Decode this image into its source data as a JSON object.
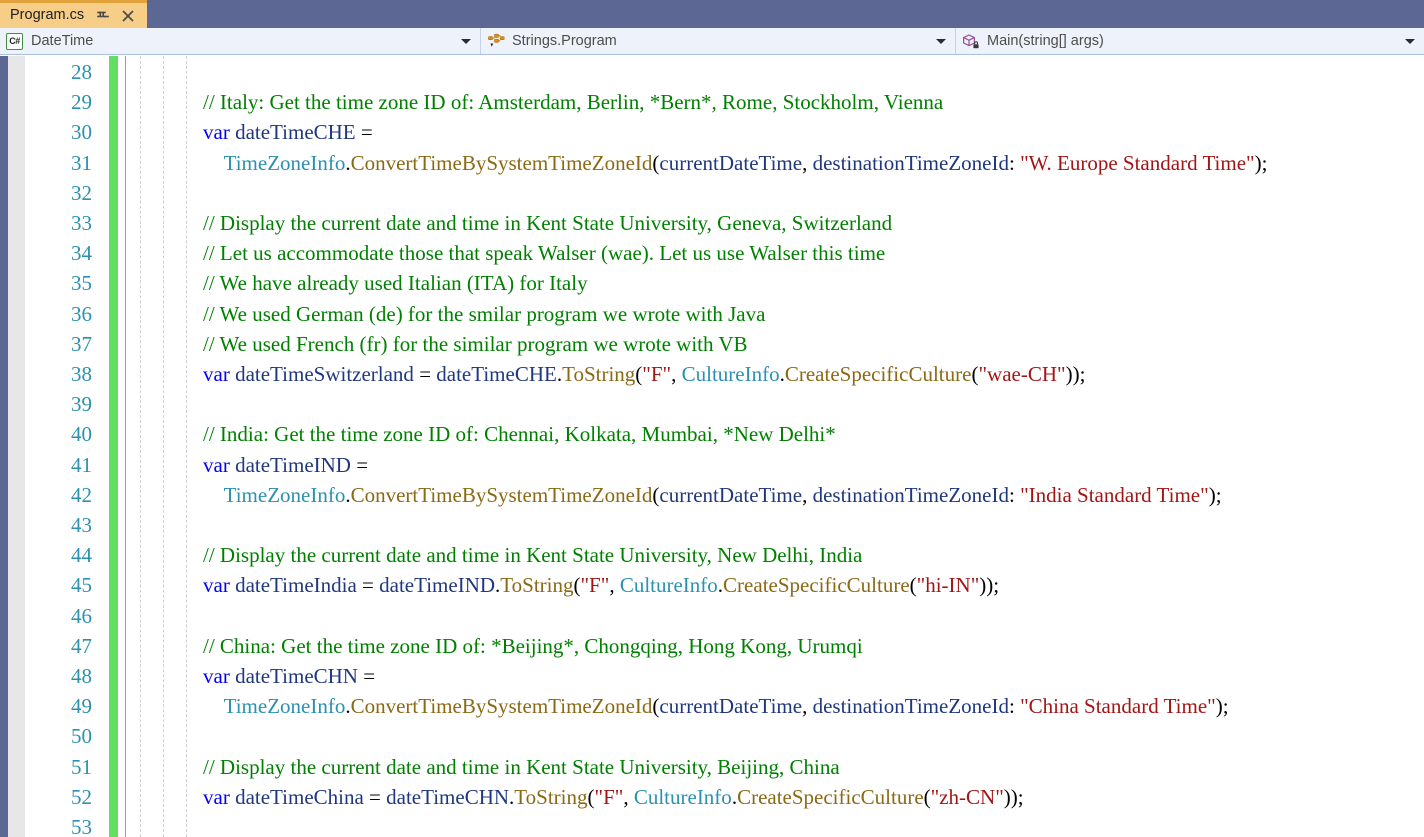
{
  "tab": {
    "title": "Program.cs",
    "pin_icon": "pin-icon",
    "close_icon": "close-icon"
  },
  "navbar": {
    "type_combo": {
      "icon": "csharp-file-icon",
      "icon_text": "C#",
      "value": "DateTime"
    },
    "class_combo": {
      "icon": "namespace-class-icon",
      "value": "Strings.Program"
    },
    "member_combo": {
      "icon": "method-private-icon",
      "value": "Main(string[] args)"
    }
  },
  "editor": {
    "first_line_number": 28,
    "colors": {
      "comment": "#008000",
      "keyword": "#0000ff",
      "type": "#2b91af",
      "method": "#8b6914",
      "string": "#a31515",
      "identifier": "#1f377f",
      "line_number": "#2b91af",
      "change_bar": "#60df60"
    },
    "lines": [
      {
        "n": 28,
        "tokens": []
      },
      {
        "n": 29,
        "tokens": [
          {
            "c": "cmt",
            "t": "// Italy: Get the time zone ID of: Amsterdam, Berlin, *Bern*, Rome, Stockholm, Vienna"
          }
        ]
      },
      {
        "n": 30,
        "tokens": [
          {
            "c": "kw",
            "t": "var"
          },
          {
            "c": "pln",
            "t": " "
          },
          {
            "c": "idn",
            "t": "dateTimeCHE"
          },
          {
            "c": "pln",
            "t": " = "
          }
        ]
      },
      {
        "n": 31,
        "tokens": [
          {
            "c": "pln",
            "t": "    "
          },
          {
            "c": "typ",
            "t": "TimeZoneInfo"
          },
          {
            "c": "pln",
            "t": "."
          },
          {
            "c": "mth",
            "t": "ConvertTimeBySystemTimeZoneId"
          },
          {
            "c": "pln",
            "t": "("
          },
          {
            "c": "idn",
            "t": "currentDateTime"
          },
          {
            "c": "pln",
            "t": ", "
          },
          {
            "c": "par",
            "t": "destinationTimeZoneId"
          },
          {
            "c": "pln",
            "t": ": "
          },
          {
            "c": "str",
            "t": "\"W. Europe Standard Time\""
          },
          {
            "c": "pln",
            "t": ");"
          }
        ]
      },
      {
        "n": 32,
        "tokens": []
      },
      {
        "n": 33,
        "tokens": [
          {
            "c": "cmt",
            "t": "// Display the current date and time in Kent State University, Geneva, Switzerland"
          }
        ]
      },
      {
        "n": 34,
        "tokens": [
          {
            "c": "cmt",
            "t": "// Let us accommodate those that speak Walser (wae). Let us use Walser this time"
          }
        ]
      },
      {
        "n": 35,
        "tokens": [
          {
            "c": "cmt",
            "t": "// We have already used Italian (ITA) for Italy"
          }
        ]
      },
      {
        "n": 36,
        "tokens": [
          {
            "c": "cmt",
            "t": "// We used German (de) for the smilar program we wrote with Java"
          }
        ]
      },
      {
        "n": 37,
        "tokens": [
          {
            "c": "cmt",
            "t": "// We used French (fr) for the similar program we wrote with VB"
          }
        ]
      },
      {
        "n": 38,
        "tokens": [
          {
            "c": "kw",
            "t": "var"
          },
          {
            "c": "pln",
            "t": " "
          },
          {
            "c": "idn",
            "t": "dateTimeSwitzerland"
          },
          {
            "c": "pln",
            "t": " = "
          },
          {
            "c": "idn",
            "t": "dateTimeCHE"
          },
          {
            "c": "pln",
            "t": "."
          },
          {
            "c": "mth",
            "t": "ToString"
          },
          {
            "c": "pln",
            "t": "("
          },
          {
            "c": "str",
            "t": "\"F\""
          },
          {
            "c": "pln",
            "t": ", "
          },
          {
            "c": "typ",
            "t": "CultureInfo"
          },
          {
            "c": "pln",
            "t": "."
          },
          {
            "c": "mth",
            "t": "CreateSpecificCulture"
          },
          {
            "c": "pln",
            "t": "("
          },
          {
            "c": "str",
            "t": "\"wae-CH\""
          },
          {
            "c": "pln",
            "t": "));"
          }
        ]
      },
      {
        "n": 39,
        "tokens": []
      },
      {
        "n": 40,
        "tokens": [
          {
            "c": "cmt",
            "t": "// India: Get the time zone ID of: Chennai, Kolkata, Mumbai, *New Delhi*"
          }
        ]
      },
      {
        "n": 41,
        "tokens": [
          {
            "c": "kw",
            "t": "var"
          },
          {
            "c": "pln",
            "t": " "
          },
          {
            "c": "idn",
            "t": "dateTimeIND"
          },
          {
            "c": "pln",
            "t": " = "
          }
        ]
      },
      {
        "n": 42,
        "tokens": [
          {
            "c": "pln",
            "t": "    "
          },
          {
            "c": "typ",
            "t": "TimeZoneInfo"
          },
          {
            "c": "pln",
            "t": "."
          },
          {
            "c": "mth",
            "t": "ConvertTimeBySystemTimeZoneId"
          },
          {
            "c": "pln",
            "t": "("
          },
          {
            "c": "idn",
            "t": "currentDateTime"
          },
          {
            "c": "pln",
            "t": ", "
          },
          {
            "c": "par",
            "t": "destinationTimeZoneId"
          },
          {
            "c": "pln",
            "t": ": "
          },
          {
            "c": "str",
            "t": "\"India Standard Time\""
          },
          {
            "c": "pln",
            "t": ");"
          }
        ]
      },
      {
        "n": 43,
        "tokens": []
      },
      {
        "n": 44,
        "tokens": [
          {
            "c": "cmt",
            "t": "// Display the current date and time in Kent State University, New Delhi, India"
          }
        ]
      },
      {
        "n": 45,
        "tokens": [
          {
            "c": "kw",
            "t": "var"
          },
          {
            "c": "pln",
            "t": " "
          },
          {
            "c": "idn",
            "t": "dateTimeIndia"
          },
          {
            "c": "pln",
            "t": " = "
          },
          {
            "c": "idn",
            "t": "dateTimeIND"
          },
          {
            "c": "pln",
            "t": "."
          },
          {
            "c": "mth",
            "t": "ToString"
          },
          {
            "c": "pln",
            "t": "("
          },
          {
            "c": "str",
            "t": "\"F\""
          },
          {
            "c": "pln",
            "t": ", "
          },
          {
            "c": "typ",
            "t": "CultureInfo"
          },
          {
            "c": "pln",
            "t": "."
          },
          {
            "c": "mth",
            "t": "CreateSpecificCulture"
          },
          {
            "c": "pln",
            "t": "("
          },
          {
            "c": "str",
            "t": "\"hi-IN\""
          },
          {
            "c": "pln",
            "t": "));"
          }
        ]
      },
      {
        "n": 46,
        "tokens": []
      },
      {
        "n": 47,
        "tokens": [
          {
            "c": "cmt",
            "t": "// China: Get the time zone ID of: *Beijing*, Chongqing, Hong Kong, Urumqi"
          }
        ]
      },
      {
        "n": 48,
        "tokens": [
          {
            "c": "kw",
            "t": "var"
          },
          {
            "c": "pln",
            "t": " "
          },
          {
            "c": "idn",
            "t": "dateTimeCHN"
          },
          {
            "c": "pln",
            "t": " = "
          }
        ]
      },
      {
        "n": 49,
        "tokens": [
          {
            "c": "pln",
            "t": "    "
          },
          {
            "c": "typ",
            "t": "TimeZoneInfo"
          },
          {
            "c": "pln",
            "t": "."
          },
          {
            "c": "mth",
            "t": "ConvertTimeBySystemTimeZoneId"
          },
          {
            "c": "pln",
            "t": "("
          },
          {
            "c": "idn",
            "t": "currentDateTime"
          },
          {
            "c": "pln",
            "t": ", "
          },
          {
            "c": "par",
            "t": "destinationTimeZoneId"
          },
          {
            "c": "pln",
            "t": ": "
          },
          {
            "c": "str",
            "t": "\"China Standard Time\""
          },
          {
            "c": "pln",
            "t": ");"
          }
        ]
      },
      {
        "n": 50,
        "tokens": []
      },
      {
        "n": 51,
        "tokens": [
          {
            "c": "cmt",
            "t": "// Display the current date and time in Kent State University, Beijing, China"
          }
        ]
      },
      {
        "n": 52,
        "tokens": [
          {
            "c": "kw",
            "t": "var"
          },
          {
            "c": "pln",
            "t": " "
          },
          {
            "c": "idn",
            "t": "dateTimeChina"
          },
          {
            "c": "pln",
            "t": " = "
          },
          {
            "c": "idn",
            "t": "dateTimeCHN"
          },
          {
            "c": "pln",
            "t": "."
          },
          {
            "c": "mth",
            "t": "ToString"
          },
          {
            "c": "pln",
            "t": "("
          },
          {
            "c": "str",
            "t": "\"F\""
          },
          {
            "c": "pln",
            "t": ", "
          },
          {
            "c": "typ",
            "t": "CultureInfo"
          },
          {
            "c": "pln",
            "t": "."
          },
          {
            "c": "mth",
            "t": "CreateSpecificCulture"
          },
          {
            "c": "pln",
            "t": "("
          },
          {
            "c": "str",
            "t": "\"zh-CN\""
          },
          {
            "c": "pln",
            "t": "));"
          }
        ]
      },
      {
        "n": 53,
        "tokens": []
      }
    ]
  }
}
